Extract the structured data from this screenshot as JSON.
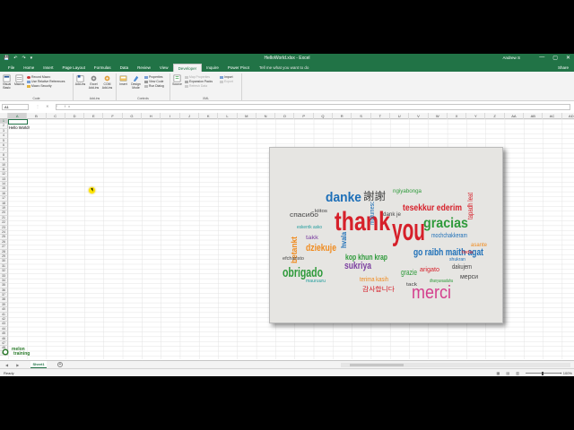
{
  "window": {
    "title": "HelloWorld.xlsx - Excel",
    "user": "Andrew S",
    "qat": [
      "💾",
      "↶",
      "↷",
      "▾"
    ],
    "controls": [
      "—",
      "▢",
      "✕"
    ]
  },
  "menu": {
    "tabs": [
      "File",
      "Home",
      "Insert",
      "Page Layout",
      "Formulas",
      "Data",
      "Review",
      "View",
      "Developer",
      "Inquire",
      "Power Pivot"
    ],
    "active_tab": "Developer",
    "tell_me": "Tell me what you want to do",
    "share": "Share"
  },
  "ribbon": {
    "code": {
      "label": "Code",
      "visual_basic": "Visual Basic",
      "macros": "Macros",
      "record_macro": "Record Macro",
      "relative_refs": "Use Relative References",
      "macro_security": "Macro Security"
    },
    "addins": {
      "label": "Add-ins",
      "add_ins": "Add-ins",
      "excel_addins": "Excel Add-ins",
      "com_addins": "COM Add-ins"
    },
    "controls": {
      "label": "Controls",
      "insert": "Insert",
      "design_mode": "Design Mode",
      "properties": "Properties",
      "view_code": "View Code",
      "run_dialog": "Run Dialog"
    },
    "xml": {
      "label": "XML",
      "source": "Source",
      "map_properties": "Map Properties",
      "expansion_packs": "Expansion Packs",
      "refresh_data": "Refresh Data",
      "import": "Import",
      "export": "Export"
    }
  },
  "formula_bar": {
    "name_box": "A1",
    "fx_icons": "⋮ ✕ ✓ fx",
    "value": ""
  },
  "grid": {
    "columns": [
      "A",
      "B",
      "C",
      "D",
      "E",
      "F",
      "G",
      "H",
      "I",
      "J",
      "K",
      "L",
      "M",
      "N",
      "O",
      "P",
      "Q",
      "R",
      "S",
      "T",
      "U",
      "V",
      "W",
      "X",
      "Y",
      "Z",
      "AA",
      "AB",
      "AC",
      "AD"
    ],
    "selected_column": "A",
    "rows": [
      "1",
      "2",
      "3",
      "4",
      "5",
      "6",
      "7",
      "8",
      "9",
      "10",
      "11",
      "12",
      "13",
      "14",
      "15",
      "16",
      "17",
      "18",
      "19",
      "20",
      "21",
      "22",
      "23",
      "24",
      "25",
      "26",
      "27",
      "28",
      "29",
      "30",
      "31",
      "32",
      "33",
      "34",
      "35",
      "36",
      "37",
      "38",
      "39",
      "40",
      "41",
      "42",
      "43",
      "44",
      "45",
      "46",
      "47",
      "48",
      "49"
    ],
    "selected_row": "1",
    "cell_a2": "Hello World!"
  },
  "picture": {
    "words": {
      "thank": "thank",
      "you": "you",
      "danke": "danke",
      "gracias": "gracias",
      "merci": "merci",
      "obrigado": "obrigado",
      "dziekuje": "dziekuje",
      "tesekkur": "tesekkur ederim",
      "go_raibh": "go raibh maith agat",
      "sukriya": "sukriya",
      "xiexie": "謝謝",
      "spasibo": "спасибо",
      "ngiyabonga": "ngiyabonga",
      "dank_je": "dank je",
      "mochchakkeram": "mochchakkeram",
      "kop_khun": "kop khun krap",
      "grazie": "grazie",
      "dakujem": "dakujem",
      "merci_ru": "мерси",
      "kamsahamnida": "감사합니다",
      "terima_kasih": "terima kasih",
      "arigato": "arigato",
      "betankt": "betankt",
      "hvala": "hvala",
      "tapadh_leat": "tapadh leat",
      "eskerrik": "eskerrik asko",
      "multumesc": "multumesc",
      "takk": "takk",
      "asante": "asante",
      "tack": "tack",
      "dhanyavaadaha": "dhanyavaadaha",
      "shukran": "shukran",
      "kiitos": "kiitos",
      "toda": "toda",
      "efcharisto": "efcharisto",
      "mauruuru": "mauruuru"
    },
    "colors": {
      "red": "#d6202a",
      "blue": "#1d6fb8",
      "green": "#2e9a3a",
      "orange": "#f08a1c",
      "purple": "#7b3fa0",
      "teal": "#1f9c9c",
      "dark": "#444444",
      "pink": "#d43f8d"
    }
  },
  "logo": {
    "line1": "melon",
    "line2": "training"
  },
  "sheets": {
    "nav": "◀ ▶",
    "tabs": [
      "Sheet1"
    ],
    "add": "+"
  },
  "status": {
    "ready": "Ready",
    "views": "▦ ▤ ▥",
    "zoom": "+ 100%"
  }
}
